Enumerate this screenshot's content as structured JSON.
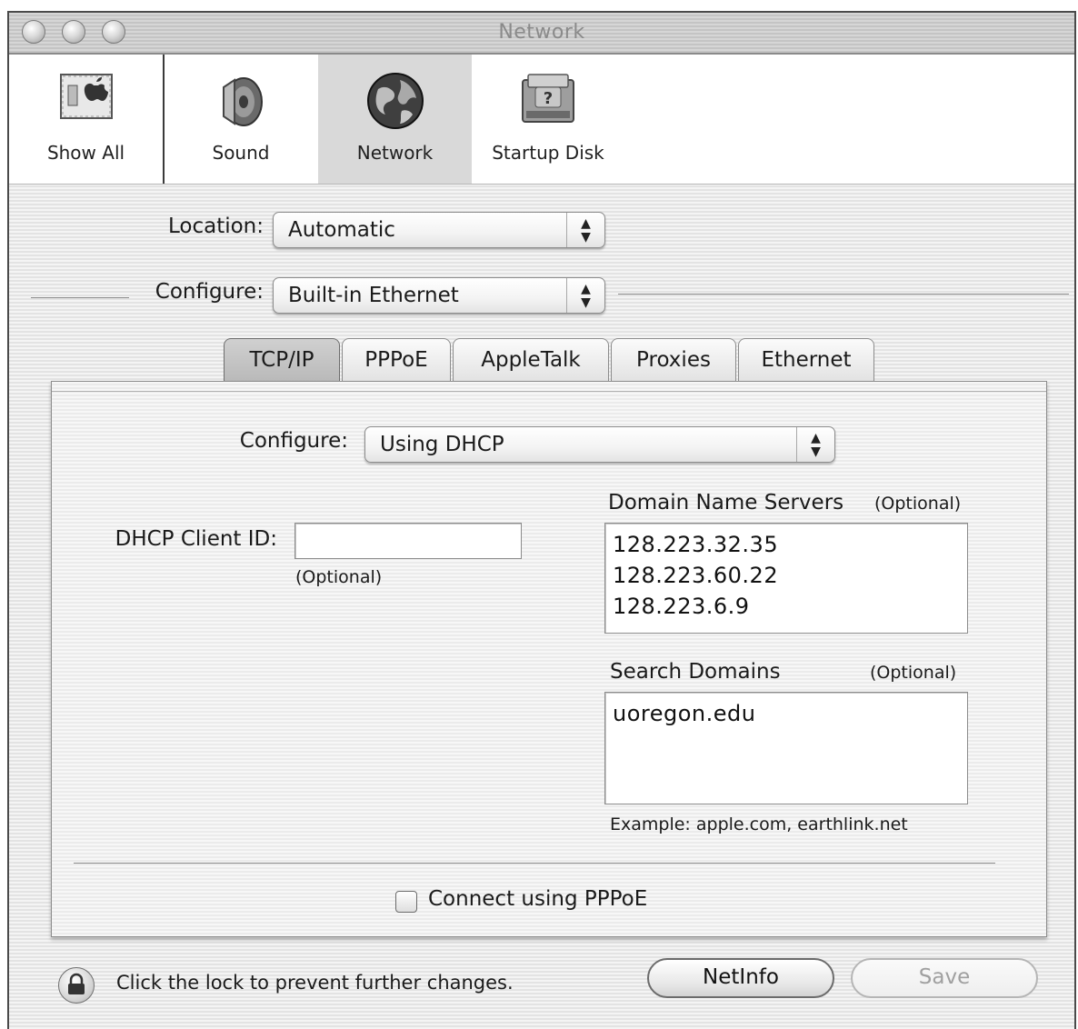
{
  "window": {
    "title": "Network"
  },
  "toolbar": {
    "items": [
      {
        "label": "Show All",
        "icon": "show-all-icon"
      },
      {
        "label": "Sound",
        "icon": "speaker-icon"
      },
      {
        "label": "Network",
        "icon": "globe-icon",
        "selected": true
      },
      {
        "label": "Startup Disk",
        "icon": "disk-icon"
      }
    ]
  },
  "location": {
    "label": "Location:",
    "value": "Automatic"
  },
  "configure": {
    "label": "Configure:",
    "value": "Built-in Ethernet"
  },
  "tabs": [
    {
      "label": "TCP/IP",
      "active": true
    },
    {
      "label": "PPPoE"
    },
    {
      "label": "AppleTalk"
    },
    {
      "label": "Proxies"
    },
    {
      "label": "Ethernet"
    }
  ],
  "tcpip": {
    "configure_label": "Configure:",
    "configure_value": "Using DHCP",
    "dhcp_client_id_label": "DHCP Client ID:",
    "dhcp_client_id_value": "",
    "dhcp_optional": "(Optional)",
    "dns_label": "Domain Name Servers",
    "dns_optional": "(Optional)",
    "dns_servers": [
      "128.223.32.35",
      "128.223.60.22",
      "128.223.6.9"
    ],
    "search_label": "Search Domains",
    "search_optional": "(Optional)",
    "search_domains": [
      "uoregon.edu"
    ],
    "example": "Example: apple.com, earthlink.net",
    "pppoe_checkbox_label": "Connect using PPPoE",
    "pppoe_checked": false
  },
  "footer": {
    "lock_text": "Click the lock to prevent further changes.",
    "netinfo_label": "NetInfo",
    "save_label": "Save"
  }
}
